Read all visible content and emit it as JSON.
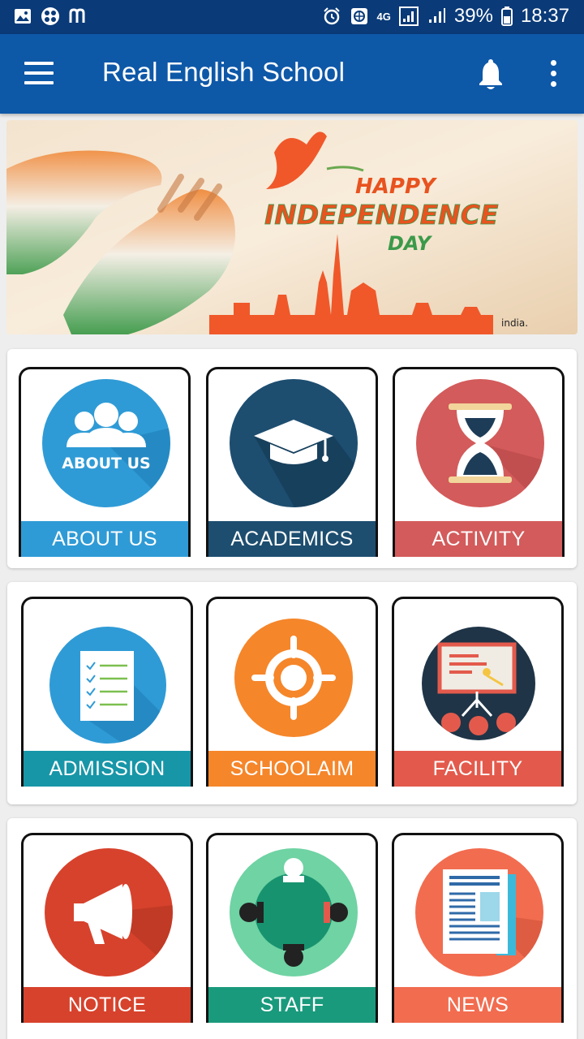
{
  "status": {
    "network": "4G",
    "battery": "39%",
    "time": "18:37",
    "icons": [
      "gallery-icon",
      "share-icon",
      "messenger-icon",
      "alarm-icon",
      "data-saver-icon",
      "signal-icon",
      "battery-icon"
    ]
  },
  "app": {
    "title": "Real English School",
    "icons": [
      "menu-icon",
      "bell-icon",
      "more-vert-icon"
    ]
  },
  "banner": {
    "line1": "HAPPY",
    "line2": "INDEPENDENCE",
    "line3": "DAY",
    "watermark": "india."
  },
  "tiles": [
    {
      "label": "ABOUT US",
      "icon_text": "ABOUT US",
      "icon": "people-icon",
      "color": "#2f9bd6"
    },
    {
      "label": "ACADEMICS",
      "icon": "graduation-cap-icon",
      "color": "#1d4e70"
    },
    {
      "label": "ACTIVITY",
      "icon": "hourglass-icon",
      "color": "#d35b5b"
    },
    {
      "label": "ADMISSION",
      "icon": "document-icon",
      "color": "#1796a8"
    },
    {
      "label": "SCHOOLAIM",
      "icon": "target-icon",
      "color": "#f5862a"
    },
    {
      "label": "FACILITY",
      "icon": "presentation-icon",
      "color": "#e35a4c"
    },
    {
      "label": "NOTICE",
      "icon": "megaphone-icon",
      "color": "#d7422c"
    },
    {
      "label": "STAFF",
      "icon": "meeting-icon",
      "color": "#1a9a7c"
    },
    {
      "label": "NEWS",
      "icon": "newspaper-icon",
      "color": "#f26c4f"
    }
  ]
}
